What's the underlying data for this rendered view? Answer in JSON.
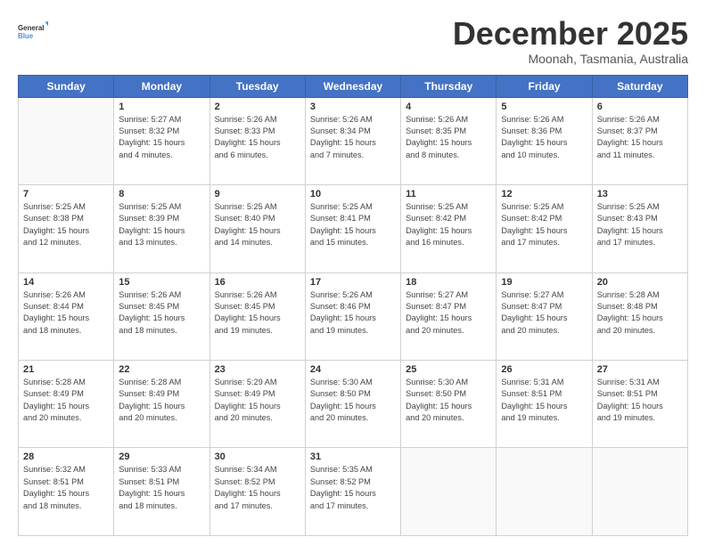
{
  "header": {
    "logo_general": "General",
    "logo_blue": "Blue",
    "month_title": "December 2025",
    "location": "Moonah, Tasmania, Australia"
  },
  "days_of_week": [
    "Sunday",
    "Monday",
    "Tuesday",
    "Wednesday",
    "Thursday",
    "Friday",
    "Saturday"
  ],
  "weeks": [
    [
      {
        "day": "",
        "content": ""
      },
      {
        "day": "1",
        "content": "Sunrise: 5:27 AM\nSunset: 8:32 PM\nDaylight: 15 hours\nand 4 minutes."
      },
      {
        "day": "2",
        "content": "Sunrise: 5:26 AM\nSunset: 8:33 PM\nDaylight: 15 hours\nand 6 minutes."
      },
      {
        "day": "3",
        "content": "Sunrise: 5:26 AM\nSunset: 8:34 PM\nDaylight: 15 hours\nand 7 minutes."
      },
      {
        "day": "4",
        "content": "Sunrise: 5:26 AM\nSunset: 8:35 PM\nDaylight: 15 hours\nand 8 minutes."
      },
      {
        "day": "5",
        "content": "Sunrise: 5:26 AM\nSunset: 8:36 PM\nDaylight: 15 hours\nand 10 minutes."
      },
      {
        "day": "6",
        "content": "Sunrise: 5:26 AM\nSunset: 8:37 PM\nDaylight: 15 hours\nand 11 minutes."
      }
    ],
    [
      {
        "day": "7",
        "content": "Sunrise: 5:25 AM\nSunset: 8:38 PM\nDaylight: 15 hours\nand 12 minutes."
      },
      {
        "day": "8",
        "content": "Sunrise: 5:25 AM\nSunset: 8:39 PM\nDaylight: 15 hours\nand 13 minutes."
      },
      {
        "day": "9",
        "content": "Sunrise: 5:25 AM\nSunset: 8:40 PM\nDaylight: 15 hours\nand 14 minutes."
      },
      {
        "day": "10",
        "content": "Sunrise: 5:25 AM\nSunset: 8:41 PM\nDaylight: 15 hours\nand 15 minutes."
      },
      {
        "day": "11",
        "content": "Sunrise: 5:25 AM\nSunset: 8:42 PM\nDaylight: 15 hours\nand 16 minutes."
      },
      {
        "day": "12",
        "content": "Sunrise: 5:25 AM\nSunset: 8:42 PM\nDaylight: 15 hours\nand 17 minutes."
      },
      {
        "day": "13",
        "content": "Sunrise: 5:25 AM\nSunset: 8:43 PM\nDaylight: 15 hours\nand 17 minutes."
      }
    ],
    [
      {
        "day": "14",
        "content": "Sunrise: 5:26 AM\nSunset: 8:44 PM\nDaylight: 15 hours\nand 18 minutes."
      },
      {
        "day": "15",
        "content": "Sunrise: 5:26 AM\nSunset: 8:45 PM\nDaylight: 15 hours\nand 18 minutes."
      },
      {
        "day": "16",
        "content": "Sunrise: 5:26 AM\nSunset: 8:45 PM\nDaylight: 15 hours\nand 19 minutes."
      },
      {
        "day": "17",
        "content": "Sunrise: 5:26 AM\nSunset: 8:46 PM\nDaylight: 15 hours\nand 19 minutes."
      },
      {
        "day": "18",
        "content": "Sunrise: 5:27 AM\nSunset: 8:47 PM\nDaylight: 15 hours\nand 20 minutes."
      },
      {
        "day": "19",
        "content": "Sunrise: 5:27 AM\nSunset: 8:47 PM\nDaylight: 15 hours\nand 20 minutes."
      },
      {
        "day": "20",
        "content": "Sunrise: 5:28 AM\nSunset: 8:48 PM\nDaylight: 15 hours\nand 20 minutes."
      }
    ],
    [
      {
        "day": "21",
        "content": "Sunrise: 5:28 AM\nSunset: 8:49 PM\nDaylight: 15 hours\nand 20 minutes."
      },
      {
        "day": "22",
        "content": "Sunrise: 5:28 AM\nSunset: 8:49 PM\nDaylight: 15 hours\nand 20 minutes."
      },
      {
        "day": "23",
        "content": "Sunrise: 5:29 AM\nSunset: 8:49 PM\nDaylight: 15 hours\nand 20 minutes."
      },
      {
        "day": "24",
        "content": "Sunrise: 5:30 AM\nSunset: 8:50 PM\nDaylight: 15 hours\nand 20 minutes."
      },
      {
        "day": "25",
        "content": "Sunrise: 5:30 AM\nSunset: 8:50 PM\nDaylight: 15 hours\nand 20 minutes."
      },
      {
        "day": "26",
        "content": "Sunrise: 5:31 AM\nSunset: 8:51 PM\nDaylight: 15 hours\nand 19 minutes."
      },
      {
        "day": "27",
        "content": "Sunrise: 5:31 AM\nSunset: 8:51 PM\nDaylight: 15 hours\nand 19 minutes."
      }
    ],
    [
      {
        "day": "28",
        "content": "Sunrise: 5:32 AM\nSunset: 8:51 PM\nDaylight: 15 hours\nand 18 minutes."
      },
      {
        "day": "29",
        "content": "Sunrise: 5:33 AM\nSunset: 8:51 PM\nDaylight: 15 hours\nand 18 minutes."
      },
      {
        "day": "30",
        "content": "Sunrise: 5:34 AM\nSunset: 8:52 PM\nDaylight: 15 hours\nand 17 minutes."
      },
      {
        "day": "31",
        "content": "Sunrise: 5:35 AM\nSunset: 8:52 PM\nDaylight: 15 hours\nand 17 minutes."
      },
      {
        "day": "",
        "content": ""
      },
      {
        "day": "",
        "content": ""
      },
      {
        "day": "",
        "content": ""
      }
    ]
  ]
}
